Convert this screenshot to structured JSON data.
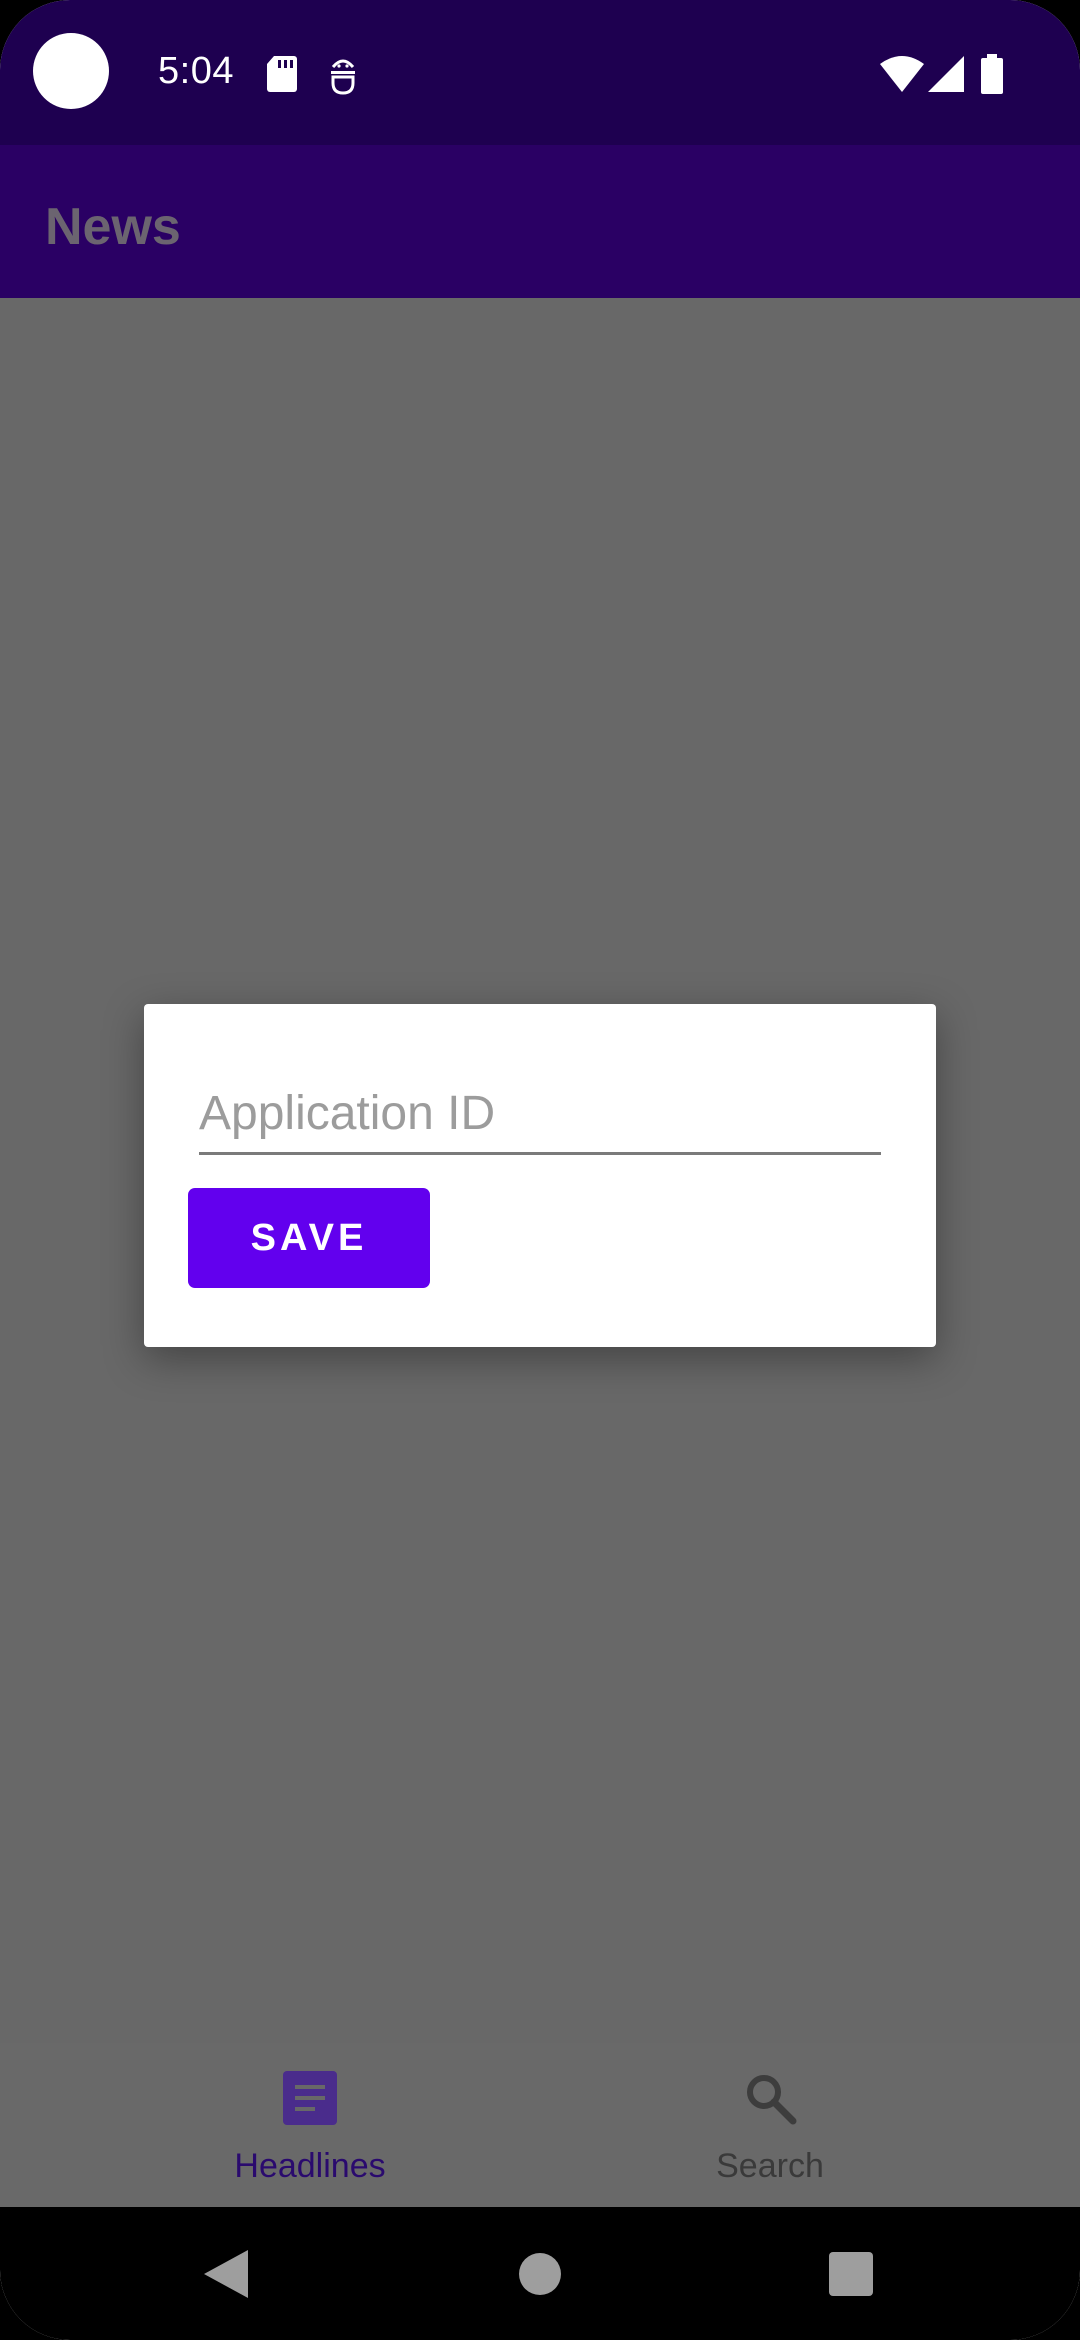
{
  "status_bar": {
    "time": "5:04",
    "icons": [
      "sd-card-icon",
      "android-debug-icon",
      "wifi-icon",
      "cell-signal-icon",
      "battery-icon"
    ]
  },
  "app_bar": {
    "title": "News"
  },
  "dialog": {
    "input_placeholder": "Application ID",
    "input_value": "",
    "save_label": "SAVE"
  },
  "bottom_nav": {
    "items": [
      {
        "label": "Headlines",
        "icon": "article-icon",
        "selected": true
      },
      {
        "label": "Search",
        "icon": "search-icon",
        "selected": false
      }
    ]
  },
  "colors": {
    "status_bar": "#1e0050",
    "app_bar": "#2a0064",
    "primary": "#6200ee",
    "scrim": "#686868",
    "nav_selected": "#2a0a6e",
    "nav_unselected": "#3a3a3a"
  }
}
